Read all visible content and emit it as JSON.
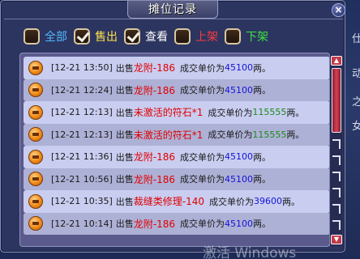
{
  "window": {
    "title": "摊位记录",
    "close_glyph": "×"
  },
  "filters": [
    {
      "label": "全部",
      "checked": false,
      "color": "#4fb9ff"
    },
    {
      "label": "售出",
      "checked": true,
      "color": "#ffe14a"
    },
    {
      "label": "查看",
      "checked": true,
      "color": "#ffffff"
    },
    {
      "label": "上架",
      "checked": false,
      "color": "#ff3b3b"
    },
    {
      "label": "下架",
      "checked": false,
      "color": "#3fe33f"
    }
  ],
  "records": [
    {
      "time": "[12-21 13:50]",
      "action": "出售",
      "item": "龙附-186",
      "mid": "成交单价为",
      "price": "45100",
      "unit": "两。",
      "price_color": "blue"
    },
    {
      "time": "[12-21 12:24]",
      "action": "出售",
      "item": "龙附-186",
      "mid": "成交单价为",
      "price": "45100",
      "unit": "两。",
      "price_color": "blue"
    },
    {
      "time": "[12-21 12:13]",
      "action": "出售",
      "item": "未激活的符石*1",
      "mid": "成交单价为",
      "price": "115555",
      "unit": "两。",
      "price_color": "green"
    },
    {
      "time": "[12-21 12:13]",
      "action": "出售",
      "item": "未激活的符石*1",
      "mid": "成交单价为",
      "price": "115555",
      "unit": "两。",
      "price_color": "green"
    },
    {
      "time": "[12-21 11:36]",
      "action": "出售",
      "item": "龙附-186",
      "mid": "成交单价为",
      "price": "45100",
      "unit": "两。",
      "price_color": "blue"
    },
    {
      "time": "[12-21 10:56]",
      "action": "出售",
      "item": "龙附-186",
      "mid": "成交单价为",
      "price": "45100",
      "unit": "两。",
      "price_color": "blue"
    },
    {
      "time": "[12-21 10:35]",
      "action": "出售",
      "item": "裁缝类修理-140",
      "mid": "成交单价为",
      "price": "39600",
      "unit": "两。",
      "price_color": "blue"
    },
    {
      "time": "[12-21 10:14]",
      "action": "出售",
      "item": "龙附-186",
      "mid": "成交单价为",
      "price": "45100",
      "unit": "两。",
      "price_color": "blue"
    }
  ],
  "background_glyphs": [
    "仕",
    "动",
    "之",
    "女"
  ],
  "watermark": "激活 Windows"
}
